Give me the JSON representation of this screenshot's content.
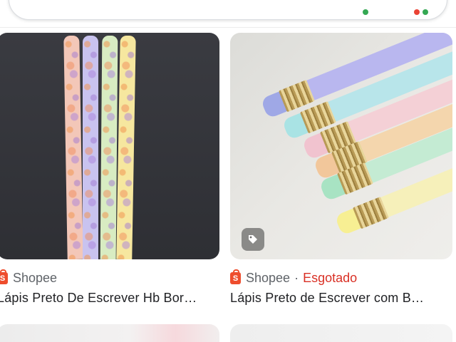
{
  "search": {
    "query": ""
  },
  "results": [
    {
      "source": "Shopee",
      "status": "",
      "title": "Lápis Preto De Escrever Hb Bor…",
      "has_tag_badge": false
    },
    {
      "source": "Shopee",
      "separator": "·",
      "status": "Esgotado",
      "title": "Lápis Preto de Escrever com B…",
      "has_tag_badge": true
    }
  ],
  "icons": {
    "source_icon": "shopee-bag-icon",
    "tag_badge": "price-tag-icon"
  },
  "colors": {
    "source_brand": "#ee4d2d",
    "status_out_of_stock": "#d93025",
    "source_text": "#5f6368",
    "title_text": "#202124"
  }
}
